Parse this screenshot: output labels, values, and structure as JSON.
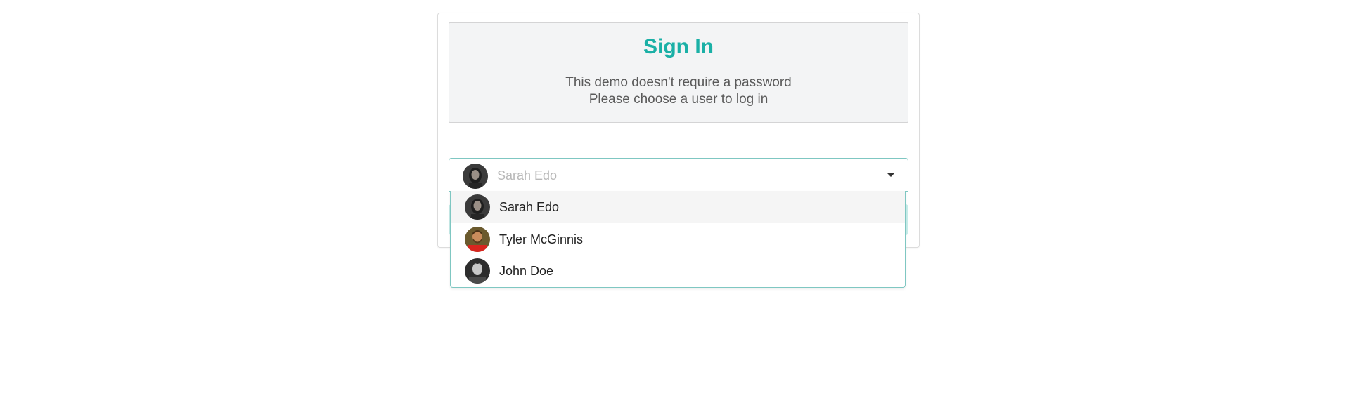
{
  "signin": {
    "title": "Sign In",
    "subtitle_line1": "This demo doesn't require a password",
    "subtitle_line2": "Please choose a user to log in"
  },
  "user_select": {
    "selected_value": "Sarah Edo",
    "caret_icon": "dropdown-caret-icon",
    "options": [
      {
        "label": "Sarah Edo",
        "avatar_icon": "sarah-edo-avatar",
        "active": true
      },
      {
        "label": "Tyler McGinnis",
        "avatar_icon": "tyler-mcginnis-avatar",
        "active": false
      },
      {
        "label": "John Doe",
        "avatar_icon": "john-doe-avatar",
        "active": false
      }
    ]
  },
  "colors": {
    "accent": "#1ab0a6",
    "header_bg": "#f3f4f5",
    "dropdown_border": "#7fc7c2",
    "active_option_bg": "#f5f5f5",
    "placeholder_text": "#b8b8b8"
  }
}
